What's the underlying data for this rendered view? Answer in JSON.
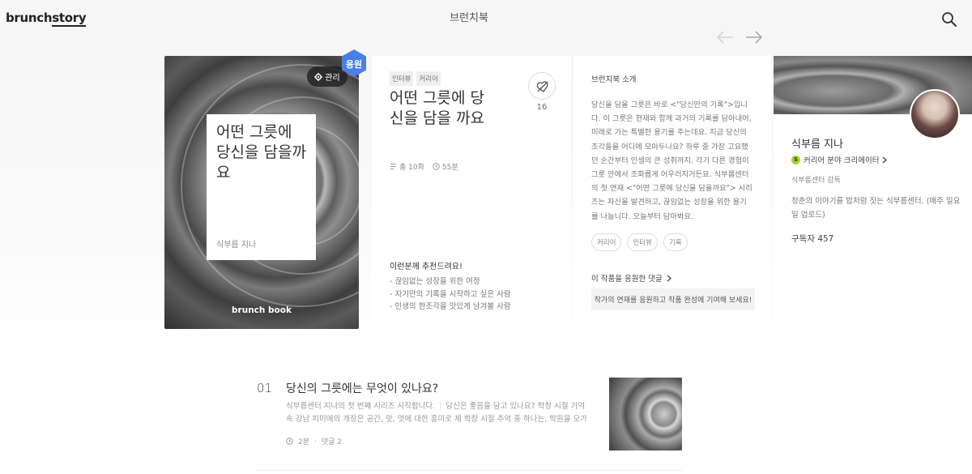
{
  "header": {
    "logo_brunch": "brunch",
    "logo_story": "story",
    "title": "브런치북"
  },
  "icons": {
    "search": "search-icon",
    "prev": "arrow-left-icon",
    "next": "arrow-right-icon",
    "gear": "gear-icon",
    "like": "heart-off-icon",
    "list": "list-icon",
    "clock": "clock-icon",
    "chevron": "chevron-right-icon"
  },
  "cover": {
    "title": "어떤 그릇에 당신을 담을까요",
    "author": "식부름 지나",
    "brand": "brunch book",
    "manage_label": "관리",
    "support_label": "응원"
  },
  "book": {
    "tags": [
      "인터뷰",
      "커리어"
    ],
    "title": "어떤 그릇에 당신을 담을 까요",
    "like_count": "16",
    "episodes": "총 10화",
    "duration": "55분",
    "recommend_title": "이런분께 추천드려요!",
    "recommend_items": [
      "끊임없는 성장을 위한 여정",
      "자기만의 기록을 시작하고 싶은 사람",
      "인생의 한조각을 맛있게 남겨볼 사람"
    ]
  },
  "intro": {
    "heading": "브런치북 소개",
    "text": "당신을 담을 그릇은 바로 <\"당신만의 기록\">입니다. 이 그릇은 현재와 함께 과거의 기록를 담아내어, 미래로 가는 특별한 용기를 주는데요. 지금 당신의 조각들을 어디에 모아두나요? 하루 중 가장 고요했던 순간부터 인생의 큰 성취까지. 각기 다른 경험이 그릇 안에서 조화롭게 어우러지거든요. 식부름센터의 첫 연재 <\"어떤 그릇에 당신을 담을까요\"> 시리즈는 자신을 발견하고, 끊임없는 성장을 위한 용기를 나눕니다. 오늘부터 담아봐요.",
    "keywords": [
      "커리어",
      "인터뷰",
      "기록"
    ],
    "comment_link": "이 작품을 응원한 댓글",
    "comment_box": "작가의 연재를 응원하고 작품 완성에 기여해 보세요!"
  },
  "author": {
    "name": "식부름 지나",
    "creator_badge": "S",
    "creator_label": "커리어 분야 크리에이터",
    "role": "식부름센터 감독",
    "description": "청춘의 이야기를 밥처럼 짓는 식부름센터. (매주 일요일 업로드)",
    "subscribers": "구독자 457"
  },
  "article": {
    "number": "01",
    "title": "당신의 그릇에는 무엇이 있나요?",
    "summary_lead": "식부름센터 지나의 첫 번째 시리즈 시작합니다.",
    "summary_rest": "당신은 좋음을 담고 있나요? 학창 시절 기억 속 강남 피미에의 개장은 공간, 맛, 멋에 대한 흥미로 제 학창 시절 추억 중 하나는, 학원을 오가며 배…",
    "read_time": "2분",
    "comments": "댓글 2"
  },
  "colors": {
    "creator_badge": "#a6d32a",
    "support_badge": "#4a7fe8"
  }
}
